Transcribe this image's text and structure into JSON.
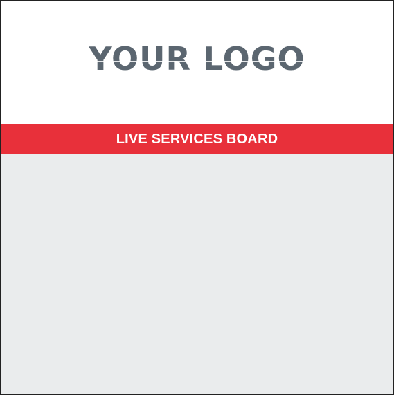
{
  "logo": {
    "text": "YOUR LOGO",
    "color": "#5b6670"
  },
  "header": {
    "title": "LIVE SERVICES BOARD",
    "background_color": "#e8303a",
    "text_color": "#ffffff"
  },
  "board": {
    "background_color": "#eaeced"
  }
}
